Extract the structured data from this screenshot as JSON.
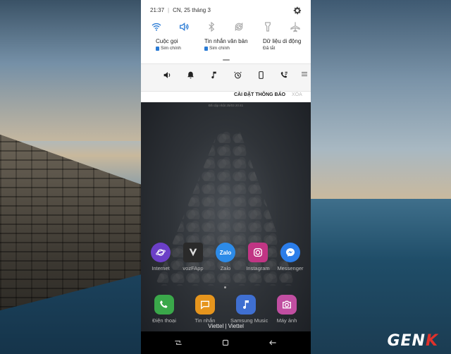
{
  "status_bar": {
    "time": "21:37",
    "separator": "|",
    "date": "CN, 25 tháng 3"
  },
  "quick_settings": [
    "wifi-icon",
    "sound-icon",
    "bluetooth-icon",
    "auto-rotate-icon",
    "flashlight-icon",
    "airplane-icon"
  ],
  "cards": [
    {
      "title": "Cuộc gọi",
      "sub": "Sim chính"
    },
    {
      "title": "Tin nhắn văn bản",
      "sub": "Sim chính"
    },
    {
      "title": "Dữ liệu di động",
      "sub": "Đã tắt"
    }
  ],
  "sound_modes": [
    "volume-icon",
    "bell-icon",
    "music-note-icon",
    "alarm-icon",
    "phone-icon",
    "call-icon"
  ],
  "notification_actions": {
    "settings": "CÀI ĐẶT THÔNG BÁO",
    "clear": "XÓA"
  },
  "home": {
    "lock_info": "Đã cập nhật 25/03 20:41",
    "apps_row1": [
      {
        "name": "Internet",
        "icon": "internet-icon",
        "color": "#6b3fc7"
      },
      {
        "name": "vozFApp",
        "icon": "vozfapp-icon",
        "color": "#2a2a2a"
      },
      {
        "name": "Zalo",
        "icon": "zalo-icon",
        "color": "#2d8be8"
      },
      {
        "name": "Instagram",
        "icon": "instagram-icon",
        "color": "#c13584"
      },
      {
        "name": "Messenger",
        "icon": "messenger-icon",
        "color": "#2b7de9"
      }
    ],
    "apps_row2": [
      {
        "name": "Điện thoại",
        "icon": "phone-app-icon",
        "color": "#3aa84a"
      },
      {
        "name": "Tin nhắn",
        "icon": "messages-app-icon",
        "color": "#e6951d"
      },
      {
        "name": "Samsung Music",
        "icon": "music-app-icon",
        "color": "#3f6fd1"
      },
      {
        "name": "Máy ảnh",
        "icon": "camera-app-icon",
        "color": "#c14ea1"
      }
    ],
    "carrier": "Viettel | Viettel"
  },
  "watermark": {
    "prefix": "GEN",
    "suffix": "K"
  },
  "colors": {
    "accent": "#2a7bd5",
    "panel_bg": "#ffffff"
  }
}
